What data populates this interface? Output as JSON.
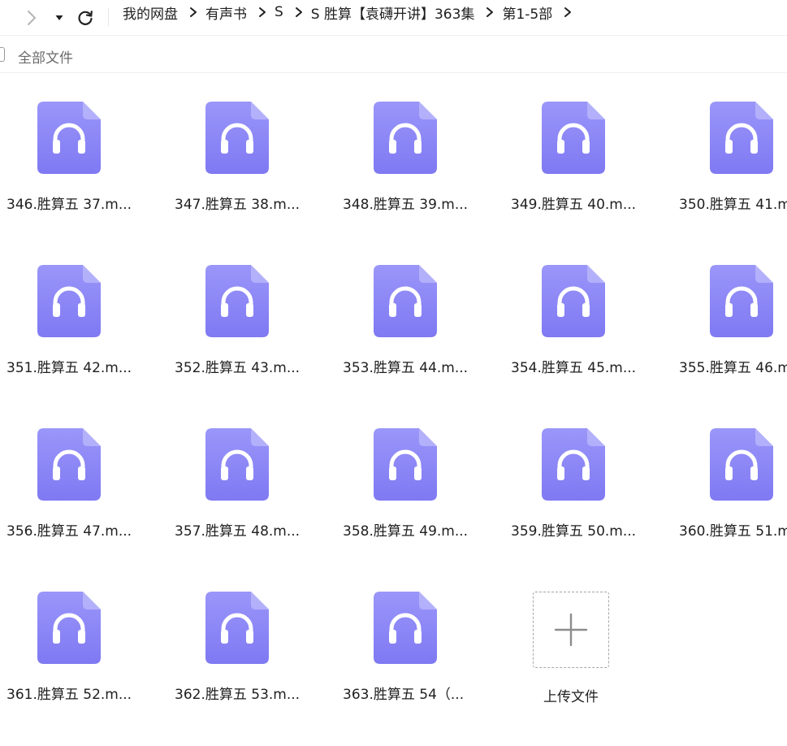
{
  "toolbar": {
    "forward_icon": "chevron-right-icon",
    "dropdown_icon": "caret-down-icon",
    "refresh_icon": "refresh-icon"
  },
  "breadcrumb": [
    {
      "label": "我的网盘"
    },
    {
      "label": "有声书"
    },
    {
      "label": "S"
    },
    {
      "label": "S 胜算【袁礴开讲】363集"
    },
    {
      "label": "第1-5部"
    }
  ],
  "subbar": {
    "select_all_label": "全部文件"
  },
  "files": [
    {
      "name": "346.胜算五 37.m..."
    },
    {
      "name": "347.胜算五 38.m..."
    },
    {
      "name": "348.胜算五 39.m..."
    },
    {
      "name": "349.胜算五 40.m..."
    },
    {
      "name": "350.胜算五 41.m"
    },
    {
      "name": "351.胜算五 42.m..."
    },
    {
      "name": "352.胜算五 43.m..."
    },
    {
      "name": "353.胜算五 44.m..."
    },
    {
      "name": "354.胜算五 45.m..."
    },
    {
      "name": "355.胜算五 46.m"
    },
    {
      "name": "356.胜算五 47.m..."
    },
    {
      "name": "357.胜算五 48.m..."
    },
    {
      "name": "358.胜算五 49.m..."
    },
    {
      "name": "359.胜算五 50.m..."
    },
    {
      "name": "360.胜算五 51.m"
    },
    {
      "name": "361.胜算五 52.m..."
    },
    {
      "name": "362.胜算五 53.m..."
    },
    {
      "name": "363.胜算五 54（..."
    }
  ],
  "upload": {
    "label": "上传文件",
    "icon": "plus-icon"
  },
  "colors": {
    "file_icon_top": "#9a96f9",
    "file_icon_bottom": "#7f79f3",
    "headphone": "#ffffff"
  }
}
